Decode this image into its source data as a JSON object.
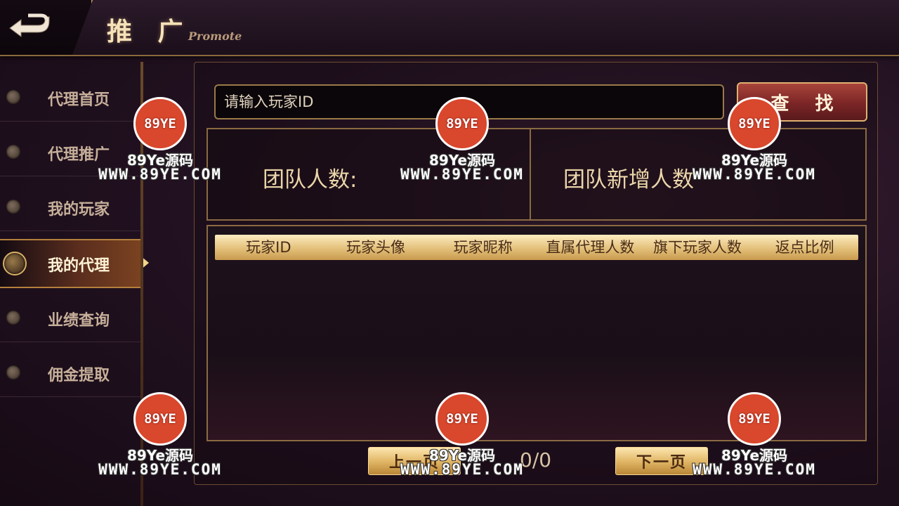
{
  "header": {
    "back_icon": "back-arrow-icon",
    "title": "推 广",
    "subtitle": "Promote"
  },
  "sidebar": {
    "items": [
      {
        "label": "代理首页",
        "active": false
      },
      {
        "label": "代理推广",
        "active": false
      },
      {
        "label": "我的玩家",
        "active": false
      },
      {
        "label": "我的代理",
        "active": true
      },
      {
        "label": "业绩查询",
        "active": false
      },
      {
        "label": "佣金提取",
        "active": false
      }
    ]
  },
  "search": {
    "placeholder": "请输入玩家ID",
    "value": "",
    "button_label": "查 找"
  },
  "stats": {
    "team_count_label": "团队人数:",
    "team_new_label": "团队新增人数"
  },
  "table": {
    "headers": [
      "玩家ID",
      "玩家头像",
      "玩家昵称",
      "直属代理人数",
      "旗下玩家人数",
      "返点比例"
    ],
    "rows": []
  },
  "pager": {
    "prev_label": "上一页",
    "next_label": "下一页",
    "indicator": "0/0"
  },
  "watermark": {
    "badge": "89YE",
    "cn": "89Ye源码",
    "url": "WWW.89YE.COM"
  },
  "colors": {
    "accent_gold": "#e3c07a",
    "search_button_red": "#7b2526",
    "watermark_red": "#d9472c"
  }
}
